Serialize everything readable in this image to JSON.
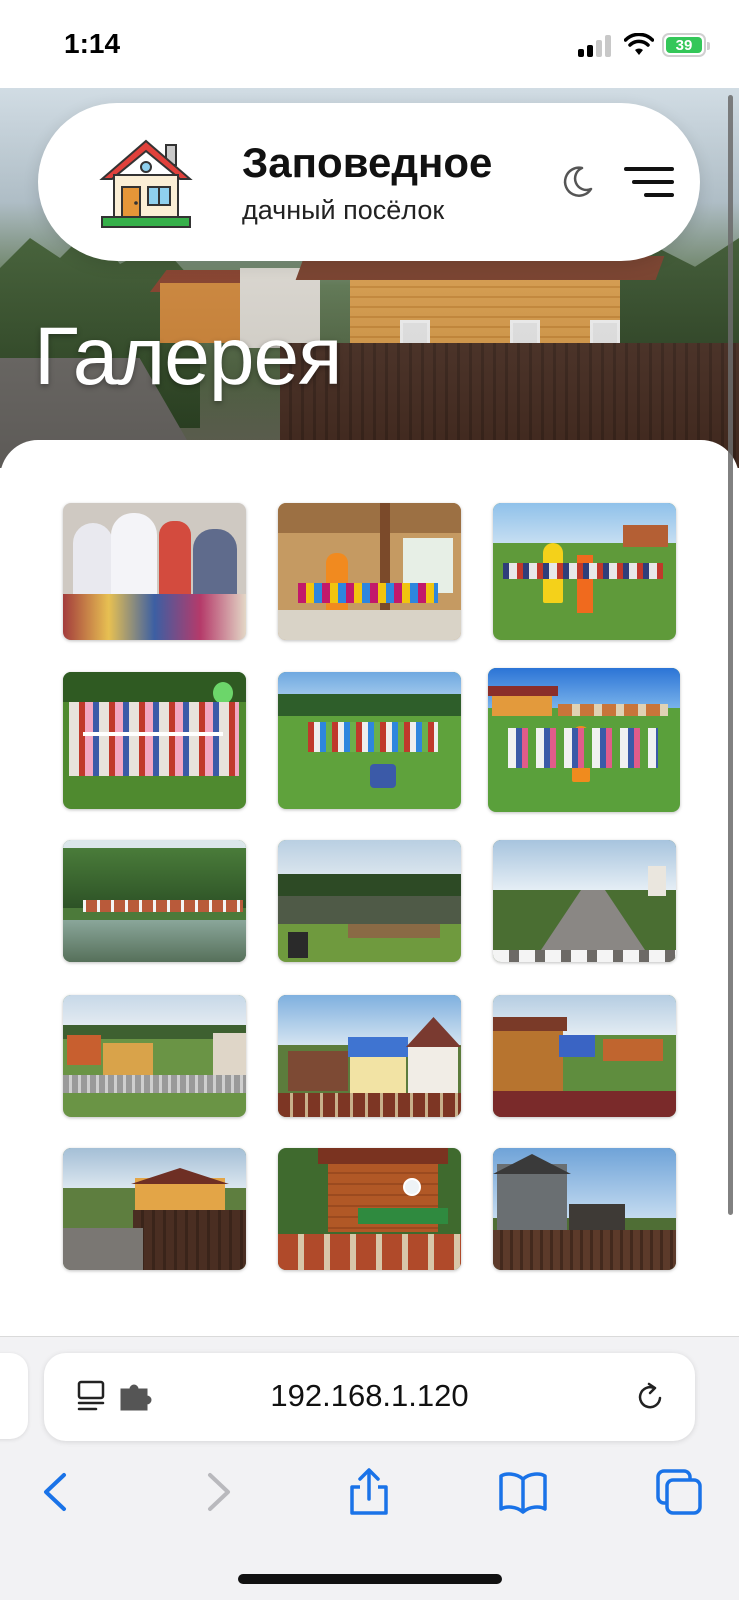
{
  "status_bar": {
    "time": "1:14",
    "battery": "39"
  },
  "header": {
    "site_name": "Заповедное",
    "site_subtitle": "дачный посёлок"
  },
  "page": {
    "title": "Галерея"
  },
  "gallery": {
    "photos": [
      {
        "name": "gallery-photo-1",
        "theme": "indoor-party"
      },
      {
        "name": "gallery-photo-2",
        "theme": "pavilion-party"
      },
      {
        "name": "gallery-photo-3",
        "theme": "kids-games-field"
      },
      {
        "name": "gallery-photo-4",
        "theme": "rope-game"
      },
      {
        "name": "gallery-photo-5",
        "theme": "kids-on-meadow"
      },
      {
        "name": "gallery-photo-6",
        "theme": "kids-near-houses"
      },
      {
        "name": "gallery-photo-7",
        "theme": "pond-playground"
      },
      {
        "name": "gallery-photo-8",
        "theme": "pond-bench"
      },
      {
        "name": "gallery-photo-9",
        "theme": "village-road"
      },
      {
        "name": "gallery-photo-10",
        "theme": "houses-fence"
      },
      {
        "name": "gallery-photo-11",
        "theme": "blue-roof-houses"
      },
      {
        "name": "gallery-photo-12",
        "theme": "houses-red-fence"
      },
      {
        "name": "gallery-photo-13",
        "theme": "yellow-house-road"
      },
      {
        "name": "gallery-photo-14",
        "theme": "brick-fence-house"
      },
      {
        "name": "gallery-photo-15",
        "theme": "grey-house-fence"
      }
    ]
  },
  "browser": {
    "address": "192.168.1.120"
  },
  "colors": {
    "accent_blue": "#1a73e8",
    "battery_green": "#34c759"
  }
}
